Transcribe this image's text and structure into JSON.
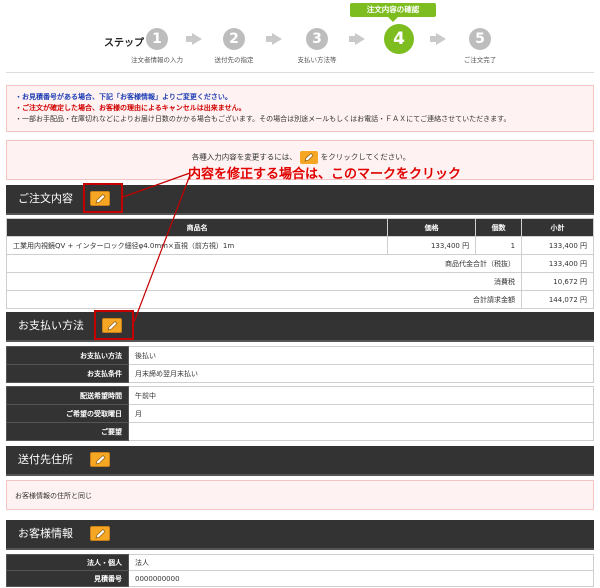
{
  "steps": {
    "label": "ステップ",
    "current_badge": "注文内容の確認",
    "items": [
      {
        "num": "1",
        "caption": "注文者情報の入力"
      },
      {
        "num": "2",
        "caption": "送付先の指定"
      },
      {
        "num": "3",
        "caption": "支払い方法等"
      },
      {
        "num": "4",
        "caption": ""
      },
      {
        "num": "5",
        "caption": "ご注文完了"
      }
    ]
  },
  "notice": {
    "line1": "・お見積番号がある場合、下記「お客様情報」よりご変更ください。",
    "line2": "・ご注文が確定した場合、お客様の理由によるキャンセルは出来ません。",
    "line3": "・一部お手配品・在庫切れなどによりお届け日数のかかる場合もございます。その場合は別途メールもしくはお電話・ＦＡＸにてご連絡させていただきます。"
  },
  "edit_note": {
    "before": "各種入力内容を変更するには、",
    "after": "をクリックしてください。"
  },
  "annotation": "内容を修正する場合は、このマークをクリック",
  "order": {
    "title": "ご注文内容",
    "headers": [
      "商品名",
      "価格",
      "個数",
      "小計"
    ],
    "item": {
      "name": "工業用内視鏡QV + インターロック細径φ4.0mm×直視（前方視）1m",
      "price": "133,400 円",
      "qty": "1",
      "subtotal": "133,400 円"
    },
    "summary": [
      {
        "label": "商品代金合計（税抜）",
        "value": "133,400 円"
      },
      {
        "label": "消費税",
        "value": "10,672 円"
      },
      {
        "label": "合計請求金額",
        "value": "144,072 円"
      }
    ]
  },
  "payment": {
    "title": "お支払い方法",
    "rows1": [
      {
        "label": "お支払い方法",
        "value": "後払い"
      },
      {
        "label": "お支払条件",
        "value": "月末締め翌月末払い"
      }
    ],
    "rows2": [
      {
        "label": "配送希望時間",
        "value": "午前中"
      },
      {
        "label": "ご希望の受取曜日",
        "value": "月"
      },
      {
        "label": "ご要望",
        "value": ""
      }
    ]
  },
  "shipping": {
    "title": "送付先住所",
    "text": "お客様情報の住所と同じ"
  },
  "customer": {
    "title": "お客様情報",
    "rows": [
      {
        "label": "法人・個人",
        "value": "法人"
      },
      {
        "label": "見積番号",
        "value": "0000000000"
      }
    ]
  },
  "colors": {
    "accent_green": "#7dbd1f",
    "pencil_orange": "#f5a623",
    "annotation_red": "#e00000",
    "header_dark": "#333333",
    "notice_pink": "#fff2f2"
  }
}
